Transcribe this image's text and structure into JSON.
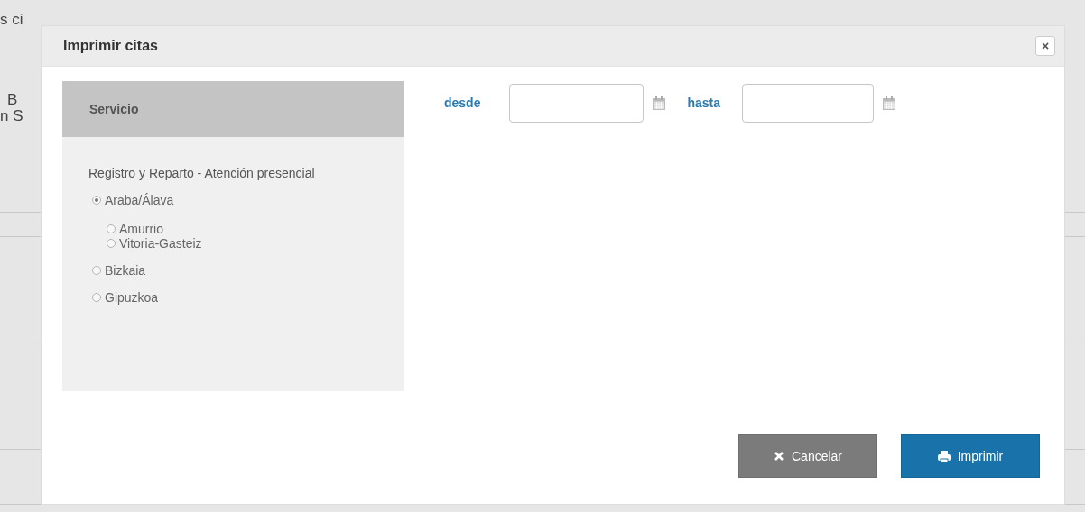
{
  "background": {
    "texts": [
      "s ci",
      "B",
      "n S"
    ]
  },
  "dialog": {
    "title": "Imprimir citas",
    "close_label": "×",
    "panel": {
      "header": "Servicio",
      "service": "Registro y Reparto - Atención presencial",
      "options": [
        {
          "label": "Araba/Álava",
          "selected": true,
          "children": [
            {
              "label": "Amurrio",
              "selected": false
            },
            {
              "label": "Vitoria-Gasteiz",
              "selected": false
            }
          ]
        },
        {
          "label": "Bizkaia",
          "selected": false
        },
        {
          "label": "Gipuzkoa",
          "selected": false
        }
      ]
    },
    "dates": [
      {
        "label": "desde"
      },
      {
        "label": "hasta"
      }
    ],
    "buttons": [
      {
        "kind": "cancel",
        "label": "Cancelar"
      },
      {
        "kind": "print",
        "label": "Imprimir"
      }
    ]
  }
}
